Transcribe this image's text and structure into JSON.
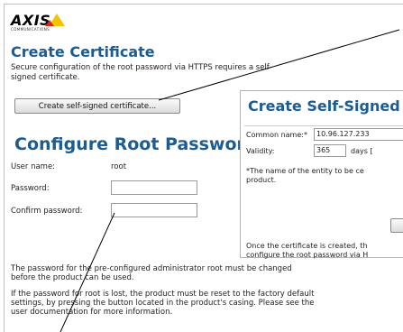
{
  "logo": {
    "word": "AXIS",
    "sub": "COMMUNICATIONS"
  },
  "create_certificate": {
    "title": "Create Certificate",
    "description": "Secure configuration of the root password via HTTPS requires a self-signed certificate.",
    "button_label": "Create self-signed certificate..."
  },
  "configure_root": {
    "title": "Configure Root Password",
    "user_name_label": "User name:",
    "user_name_value": "root",
    "password_label": "Password:",
    "password_value": "",
    "confirm_label": "Confirm password:",
    "confirm_value": ""
  },
  "dialog": {
    "title": "Create Self-Signed",
    "common_name_label": "Common name:*",
    "common_name_value": "10.96.127.233",
    "validity_label": "Validity:",
    "validity_value": "365",
    "validity_unit": "days [",
    "note_line1": "*The name of the entity to be ce",
    "note_line2": "product.",
    "after_line1": "Once the certificate is created, th",
    "after_line2": "configure the root password via H"
  },
  "footer": {
    "line1": "The password for the pre-configured administrator root must be changed",
    "line2": "before the product can be used.",
    "line3": "If the password for root is lost, the product must be reset to the factory default",
    "line4": "settings, by pressing the button located in the product's casing. Please see the",
    "line5": "user documentation for more information."
  }
}
